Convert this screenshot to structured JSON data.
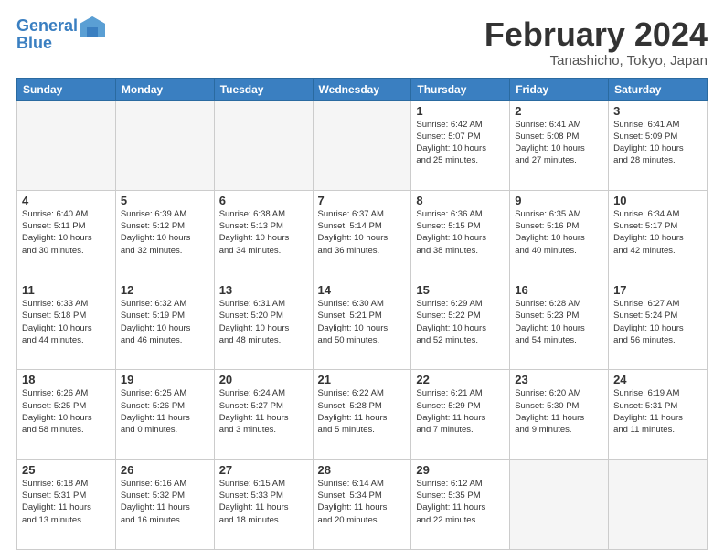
{
  "header": {
    "logo_line1": "General",
    "logo_line2": "Blue",
    "title": "February 2024",
    "subtitle": "Tanashicho, Tokyo, Japan"
  },
  "days_of_week": [
    "Sunday",
    "Monday",
    "Tuesday",
    "Wednesday",
    "Thursday",
    "Friday",
    "Saturday"
  ],
  "weeks": [
    [
      {
        "day": "",
        "info": ""
      },
      {
        "day": "",
        "info": ""
      },
      {
        "day": "",
        "info": ""
      },
      {
        "day": "",
        "info": ""
      },
      {
        "day": "1",
        "info": "Sunrise: 6:42 AM\nSunset: 5:07 PM\nDaylight: 10 hours\nand 25 minutes."
      },
      {
        "day": "2",
        "info": "Sunrise: 6:41 AM\nSunset: 5:08 PM\nDaylight: 10 hours\nand 27 minutes."
      },
      {
        "day": "3",
        "info": "Sunrise: 6:41 AM\nSunset: 5:09 PM\nDaylight: 10 hours\nand 28 minutes."
      }
    ],
    [
      {
        "day": "4",
        "info": "Sunrise: 6:40 AM\nSunset: 5:11 PM\nDaylight: 10 hours\nand 30 minutes."
      },
      {
        "day": "5",
        "info": "Sunrise: 6:39 AM\nSunset: 5:12 PM\nDaylight: 10 hours\nand 32 minutes."
      },
      {
        "day": "6",
        "info": "Sunrise: 6:38 AM\nSunset: 5:13 PM\nDaylight: 10 hours\nand 34 minutes."
      },
      {
        "day": "7",
        "info": "Sunrise: 6:37 AM\nSunset: 5:14 PM\nDaylight: 10 hours\nand 36 minutes."
      },
      {
        "day": "8",
        "info": "Sunrise: 6:36 AM\nSunset: 5:15 PM\nDaylight: 10 hours\nand 38 minutes."
      },
      {
        "day": "9",
        "info": "Sunrise: 6:35 AM\nSunset: 5:16 PM\nDaylight: 10 hours\nand 40 minutes."
      },
      {
        "day": "10",
        "info": "Sunrise: 6:34 AM\nSunset: 5:17 PM\nDaylight: 10 hours\nand 42 minutes."
      }
    ],
    [
      {
        "day": "11",
        "info": "Sunrise: 6:33 AM\nSunset: 5:18 PM\nDaylight: 10 hours\nand 44 minutes."
      },
      {
        "day": "12",
        "info": "Sunrise: 6:32 AM\nSunset: 5:19 PM\nDaylight: 10 hours\nand 46 minutes."
      },
      {
        "day": "13",
        "info": "Sunrise: 6:31 AM\nSunset: 5:20 PM\nDaylight: 10 hours\nand 48 minutes."
      },
      {
        "day": "14",
        "info": "Sunrise: 6:30 AM\nSunset: 5:21 PM\nDaylight: 10 hours\nand 50 minutes."
      },
      {
        "day": "15",
        "info": "Sunrise: 6:29 AM\nSunset: 5:22 PM\nDaylight: 10 hours\nand 52 minutes."
      },
      {
        "day": "16",
        "info": "Sunrise: 6:28 AM\nSunset: 5:23 PM\nDaylight: 10 hours\nand 54 minutes."
      },
      {
        "day": "17",
        "info": "Sunrise: 6:27 AM\nSunset: 5:24 PM\nDaylight: 10 hours\nand 56 minutes."
      }
    ],
    [
      {
        "day": "18",
        "info": "Sunrise: 6:26 AM\nSunset: 5:25 PM\nDaylight: 10 hours\nand 58 minutes."
      },
      {
        "day": "19",
        "info": "Sunrise: 6:25 AM\nSunset: 5:26 PM\nDaylight: 11 hours\nand 0 minutes."
      },
      {
        "day": "20",
        "info": "Sunrise: 6:24 AM\nSunset: 5:27 PM\nDaylight: 11 hours\nand 3 minutes."
      },
      {
        "day": "21",
        "info": "Sunrise: 6:22 AM\nSunset: 5:28 PM\nDaylight: 11 hours\nand 5 minutes."
      },
      {
        "day": "22",
        "info": "Sunrise: 6:21 AM\nSunset: 5:29 PM\nDaylight: 11 hours\nand 7 minutes."
      },
      {
        "day": "23",
        "info": "Sunrise: 6:20 AM\nSunset: 5:30 PM\nDaylight: 11 hours\nand 9 minutes."
      },
      {
        "day": "24",
        "info": "Sunrise: 6:19 AM\nSunset: 5:31 PM\nDaylight: 11 hours\nand 11 minutes."
      }
    ],
    [
      {
        "day": "25",
        "info": "Sunrise: 6:18 AM\nSunset: 5:31 PM\nDaylight: 11 hours\nand 13 minutes."
      },
      {
        "day": "26",
        "info": "Sunrise: 6:16 AM\nSunset: 5:32 PM\nDaylight: 11 hours\nand 16 minutes."
      },
      {
        "day": "27",
        "info": "Sunrise: 6:15 AM\nSunset: 5:33 PM\nDaylight: 11 hours\nand 18 minutes."
      },
      {
        "day": "28",
        "info": "Sunrise: 6:14 AM\nSunset: 5:34 PM\nDaylight: 11 hours\nand 20 minutes."
      },
      {
        "day": "29",
        "info": "Sunrise: 6:12 AM\nSunset: 5:35 PM\nDaylight: 11 hours\nand 22 minutes."
      },
      {
        "day": "",
        "info": ""
      },
      {
        "day": "",
        "info": ""
      }
    ]
  ]
}
